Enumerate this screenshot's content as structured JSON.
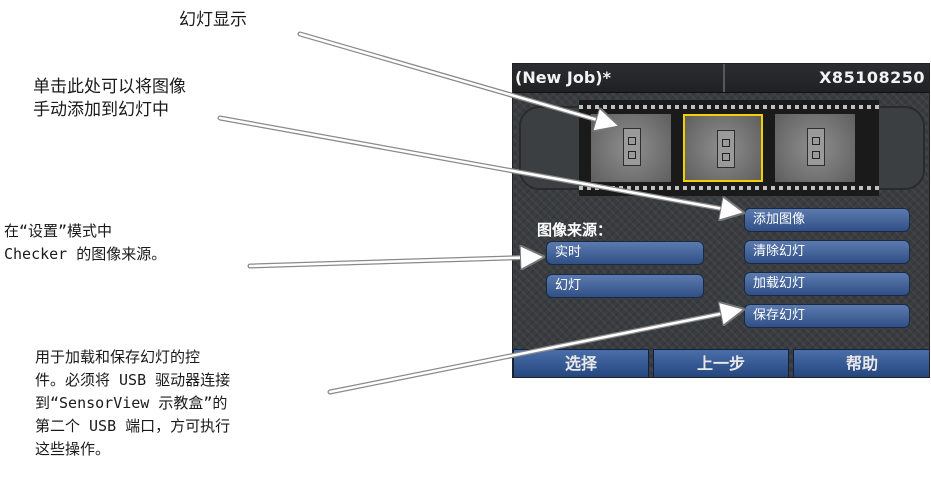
{
  "callouts": {
    "slideshow": "幻灯显示",
    "add_manual": "单击此处可以将图像\n手动添加到幻灯中",
    "image_source": "在“设置”模式中\nChecker 的图像来源。",
    "load_save": "用于加载和保存幻灯的控\n件。必须将 USB 驱动器连接\n到“SensorView 示教盒”的\n第二个 USB 端口，方可执行\n这些操作。"
  },
  "panel": {
    "job_name": "(New Job)*",
    "serial": "X85108250",
    "image_source_label": "图像来源：",
    "source_buttons": {
      "live": "实时",
      "slides": "幻灯"
    },
    "action_buttons": {
      "add_image": "添加图像",
      "clear_slides": "清除幻灯",
      "load_slides": "加载幻灯",
      "save_slides": "保存幻灯"
    },
    "bottom_nav": {
      "select": "选择",
      "back": "上一步",
      "help": "帮助"
    }
  },
  "colors": {
    "accent_blue": "#3a5a94",
    "selection_yellow": "#f5d000",
    "panel_dark": "#3a3d40"
  }
}
